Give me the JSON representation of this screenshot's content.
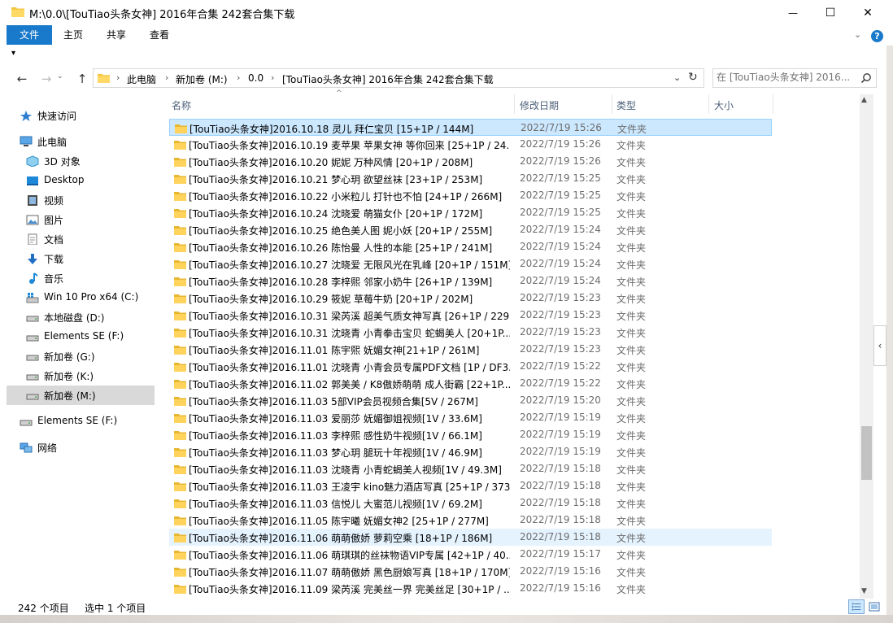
{
  "window": {
    "title": "M:\\0.0\\[TouTiao头条女神] 2016年合集 242套合集下载",
    "minimize": "—",
    "maximize": "☐",
    "close": "✕"
  },
  "ribbon": {
    "tabs": [
      "文件",
      "主页",
      "共享",
      "查看"
    ],
    "expand": "⌄",
    "help": "?",
    "qat": "▾"
  },
  "nav": {
    "back": "←",
    "forward": "→",
    "up": "↑",
    "breadcrumb": [
      "此电脑",
      "新加卷 (M:)",
      "0.0",
      "[TouTiao头条女神] 2016年合集 242套合集下载"
    ],
    "separator": "›",
    "dropdown": "⌄",
    "refresh": "↻",
    "search_placeholder": "在 [TouTiao头条女神] 2016..."
  },
  "sidebar": {
    "items": [
      {
        "label": "快速访问",
        "icon": "star-icon"
      },
      {
        "label": "此电脑",
        "icon": "computer-icon"
      },
      {
        "label": "3D 对象",
        "icon": "cube-icon"
      },
      {
        "label": "Desktop",
        "icon": "desktop-icon"
      },
      {
        "label": "视频",
        "icon": "video-icon"
      },
      {
        "label": "图片",
        "icon": "picture-icon"
      },
      {
        "label": "文档",
        "icon": "document-icon"
      },
      {
        "label": "下载",
        "icon": "download-icon"
      },
      {
        "label": "音乐",
        "icon": "music-icon"
      },
      {
        "label": "Win 10 Pro x64 (C:)",
        "icon": "windows-drive-icon"
      },
      {
        "label": "本地磁盘 (D:)",
        "icon": "drive-icon"
      },
      {
        "label": "Elements SE (F:)",
        "icon": "drive-icon"
      },
      {
        "label": "新加卷 (G:)",
        "icon": "drive-icon"
      },
      {
        "label": "新加卷 (K:)",
        "icon": "drive-icon"
      },
      {
        "label": "新加卷 (M:)",
        "icon": "drive-icon"
      },
      {
        "label": "Elements SE (F:)",
        "icon": "drive-icon"
      },
      {
        "label": "网络",
        "icon": "network-icon"
      }
    ]
  },
  "columns": {
    "name": "名称",
    "date": "修改日期",
    "type": "类型",
    "size": "大小",
    "sort_indicator": "^"
  },
  "files": [
    {
      "name": "[TouTiao头条女神]2016.10.18 灵儿 拜仁宝贝 [15+1P / 144M]",
      "date": "2022/7/19 15:26",
      "type": "文件夹"
    },
    {
      "name": "[TouTiao头条女神]2016.10.19 麦苹果 苹果女神 等你回来 [25+1P / 24...",
      "date": "2022/7/19 15:26",
      "type": "文件夹"
    },
    {
      "name": "[TouTiao头条女神]2016.10.20 妮妮 万种风情 [20+1P / 208M]",
      "date": "2022/7/19 15:26",
      "type": "文件夹"
    },
    {
      "name": "[TouTiao头条女神]2016.10.21 梦心玥 欲望丝袜 [23+1P / 253M]",
      "date": "2022/7/19 15:25",
      "type": "文件夹"
    },
    {
      "name": "[TouTiao头条女神]2016.10.22 小米粒儿 打针也不怕 [24+1P / 266M]",
      "date": "2022/7/19 15:25",
      "type": "文件夹"
    },
    {
      "name": "[TouTiao头条女神]2016.10.24 沈晓爱 萌猫女仆 [20+1P / 172M]",
      "date": "2022/7/19 15:25",
      "type": "文件夹"
    },
    {
      "name": "[TouTiao头条女神]2016.10.25 绝色美人图 妮小妖 [20+1P / 255M]",
      "date": "2022/7/19 15:24",
      "type": "文件夹"
    },
    {
      "name": "[TouTiao头条女神]2016.10.26 陈怡曼 人性的本能 [25+1P / 241M]",
      "date": "2022/7/19 15:24",
      "type": "文件夹"
    },
    {
      "name": "[TouTiao头条女神]2016.10.27 沈晓爱 无限风光在乳峰 [20+1P / 151M]",
      "date": "2022/7/19 15:24",
      "type": "文件夹"
    },
    {
      "name": "[TouTiao头条女神]2016.10.28 李梓熙 邻家小奶牛 [26+1P / 139M]",
      "date": "2022/7/19 15:24",
      "type": "文件夹"
    },
    {
      "name": "[TouTiao头条女神]2016.10.29 筱妮 草莓牛奶 [20+1P / 202M]",
      "date": "2022/7/19 15:23",
      "type": "文件夹"
    },
    {
      "name": "[TouTiao头条女神]2016.10.31 梁芮溪 超美气质女神写真 [26+1P / 229...",
      "date": "2022/7/19 15:23",
      "type": "文件夹"
    },
    {
      "name": "[TouTiao头条女神]2016.10.31 沈晓青 小青拳击宝贝 蛇蝎美人 [20+1P...",
      "date": "2022/7/19 15:23",
      "type": "文件夹"
    },
    {
      "name": "[TouTiao头条女神]2016.11.01 陈宇熙 妩媚女神[21+1P / 261M]",
      "date": "2022/7/19 15:23",
      "type": "文件夹"
    },
    {
      "name": "[TouTiao头条女神]2016.11.01 沈晓青 小青会员专属PDF文档 [1P / DF3...",
      "date": "2022/7/19 15:22",
      "type": "文件夹"
    },
    {
      "name": "[TouTiao头条女神]2016.11.02 郭美美 / K8傲娇萌萌 成人街霸 [22+1P...",
      "date": "2022/7/19 15:22",
      "type": "文件夹"
    },
    {
      "name": "[TouTiao头条女神]2016.11.03 5部VIP会员视频合集[5V / 267M]",
      "date": "2022/7/19 15:20",
      "type": "文件夹"
    },
    {
      "name": "[TouTiao头条女神]2016.11.03 爱丽莎 妩媚御姐视频[1V / 33.6M]",
      "date": "2022/7/19 15:19",
      "type": "文件夹"
    },
    {
      "name": "[TouTiao头条女神]2016.11.03 李梓熙 感性奶牛视频[1V / 66.1M]",
      "date": "2022/7/19 15:19",
      "type": "文件夹"
    },
    {
      "name": "[TouTiao头条女神]2016.11.03 梦心玥 腿玩十年视频[1V / 46.9M]",
      "date": "2022/7/19 15:19",
      "type": "文件夹"
    },
    {
      "name": "[TouTiao头条女神]2016.11.03 沈晓青 小青蛇蝎美人视频[1V / 49.3M]",
      "date": "2022/7/19 15:18",
      "type": "文件夹"
    },
    {
      "name": "[TouTiao头条女神]2016.11.03 王凌宇 kino魅力酒店写真 [25+1P / 373...",
      "date": "2022/7/19 15:18",
      "type": "文件夹"
    },
    {
      "name": "[TouTiao头条女神]2016.11.03 信悦儿 大蜜范儿视频[1V / 69.2M]",
      "date": "2022/7/19 15:18",
      "type": "文件夹"
    },
    {
      "name": "[TouTiao头条女神]2016.11.05 陈宇曦 妩媚女神2 [25+1P / 277M]",
      "date": "2022/7/19 15:18",
      "type": "文件夹"
    },
    {
      "name": "[TouTiao头条女神]2016.11.06 萌萌傲娇 萝莉空乘 [18+1P / 186M]",
      "date": "2022/7/19 15:18",
      "type": "文件夹"
    },
    {
      "name": "[TouTiao头条女神]2016.11.06 萌琪琪的丝袜物语VIP专属 [42+1P / 40...",
      "date": "2022/7/19 15:17",
      "type": "文件夹"
    },
    {
      "name": "[TouTiao头条女神]2016.11.07 萌萌傲娇 黑色厨娘写真 [18+1P / 170M]",
      "date": "2022/7/19 15:16",
      "type": "文件夹"
    },
    {
      "name": "[TouTiao头条女神]2016.11.09 梁芮溪 完美丝一界 完美丝足 [30+1P / ...",
      "date": "2022/7/19 15:16",
      "type": "文件夹"
    }
  ],
  "status": {
    "count": "242 个项目",
    "selected": "选中 1 个项目"
  },
  "scrollbar": {
    "up": "▲",
    "down": "▼",
    "preview_toggle": "‹"
  },
  "colors": {
    "accent": "#1979ca",
    "folder": "#f4c542",
    "selection": "#cce8ff",
    "hover": "#e5f3ff"
  }
}
